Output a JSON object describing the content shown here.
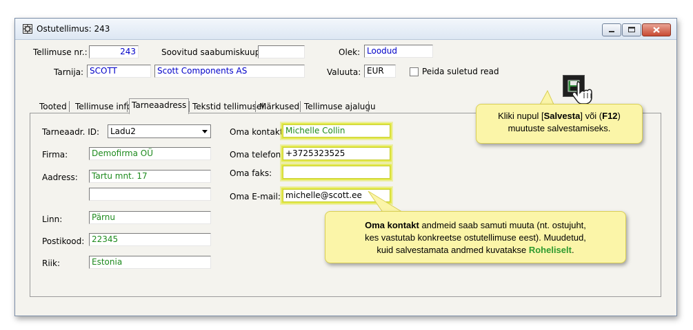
{
  "window": {
    "title": "Ostutellimus: 243"
  },
  "header": {
    "order_no_label": "Tellimuse nr.:",
    "order_no": "243",
    "desired_date_label": "Soovitud saabumiskuup.:",
    "desired_date": "",
    "state_label": "Olek:",
    "state": "Loodud",
    "supplier_label": "Tarnija:",
    "supplier_code": "SCOTT",
    "supplier_name": "Scott Components AS",
    "currency_label": "Valuuta:",
    "currency": "EUR",
    "hide_closed_label": "Peida suletud read"
  },
  "tabs": [
    {
      "label": "Tooted"
    },
    {
      "label": "Tellimuse info"
    },
    {
      "label": "Tarneaadress"
    },
    {
      "label": "Tekstid tellimusel"
    },
    {
      "label": "Märkused"
    },
    {
      "label": "Tellimuse ajalugu"
    }
  ],
  "delivery": {
    "addr_id_label": "Tarneaadr. ID:",
    "addr_id": "Ladu2",
    "company_label": "Firma:",
    "company": "Demofirma OÜ",
    "address_label": "Aadress:",
    "address1": "Tartu mnt. 17",
    "address2": "",
    "city_label": "Linn:",
    "city": "Pärnu",
    "zip_label": "Postikood:",
    "zip": "22345",
    "country_label": "Riik:",
    "country": "Estonia"
  },
  "contact": {
    "name_label": "Oma kontakt:",
    "name": "Michelle Collin",
    "phone_label": "Oma telefon:",
    "phone": "+3725323525",
    "fax_label": "Oma faks:",
    "fax": "",
    "email_label": "Oma E-mail:",
    "email": "michelle@scott.ee"
  },
  "callouts": {
    "save": {
      "p1": "Kliki nupul [",
      "b1": "Salvesta",
      "p2": "] või (",
      "b2": "F12",
      "p3": ")",
      "line2": "muutuste salvestamiseks."
    },
    "contact": {
      "b1": "Oma kontakt",
      "p1": " andmeid saab samuti muuta (nt. ostujuht,",
      "line2": "kes vastutab konkreetse ostutellimuse eest). Muudetud,",
      "p3": "kuid salvestamata andmed kuvatakse ",
      "g1": "Roheliselt",
      "p4": "."
    }
  },
  "colors": {
    "changed_text": "#1d8a1d",
    "field_text": "#0000c8",
    "highlight": "#e3e94a",
    "callout_bg": "#fbf5a8"
  }
}
